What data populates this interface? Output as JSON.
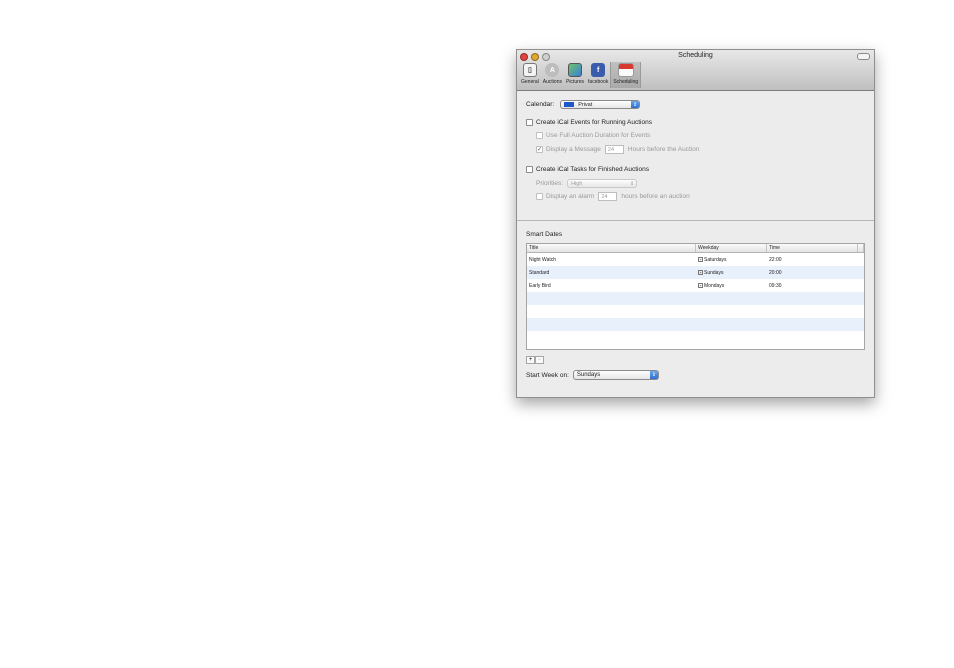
{
  "window": {
    "title": "Scheduling"
  },
  "toolbar": {
    "items": [
      {
        "label": "General",
        "icon": "general-icon"
      },
      {
        "label": "Auctions",
        "icon": "auctions-icon"
      },
      {
        "label": "Pictures",
        "icon": "pictures-icon"
      },
      {
        "label": "facebook",
        "icon": "facebook-icon"
      },
      {
        "label": "Scheduling",
        "icon": "calendar-icon",
        "selected": true
      }
    ]
  },
  "calendar": {
    "label": "Calendar:",
    "value": "Privat",
    "color": "#1d58c8"
  },
  "events": {
    "label": "Create iCal Events for Running Auctions",
    "checked": false,
    "full_duration_label": "Use Full Auction Duration for Events",
    "display_message_prefix": "Display a Message",
    "display_message_hours": "24",
    "display_message_suffix": "Hours before the Auction"
  },
  "tasks": {
    "label": "Create iCal Tasks for Finished Auctions",
    "checked": false,
    "priorities_label": "Priorities:",
    "priorities_value": "High",
    "alarm_prefix": "Display an alarm",
    "alarm_hours": "24",
    "alarm_suffix": "hours before an auction"
  },
  "smart_dates": {
    "label": "Smart Dates",
    "columns": [
      "Title",
      "Weekday",
      "Time"
    ],
    "rows": [
      {
        "title": "Night Watch",
        "weekday": "Saturdays",
        "time": "22:00"
      },
      {
        "title": "Standard",
        "weekday": "Sundays",
        "time": "20:00"
      },
      {
        "title": "Early Bird",
        "weekday": "Mondays",
        "time": "09:30"
      }
    ],
    "add_label": "+",
    "remove_label": "−"
  },
  "start_week": {
    "label": "Start Week on:",
    "value": "Sundays"
  },
  "colors": {
    "accent": "#2f6fd0",
    "row_alt": "#e8f0fc"
  }
}
